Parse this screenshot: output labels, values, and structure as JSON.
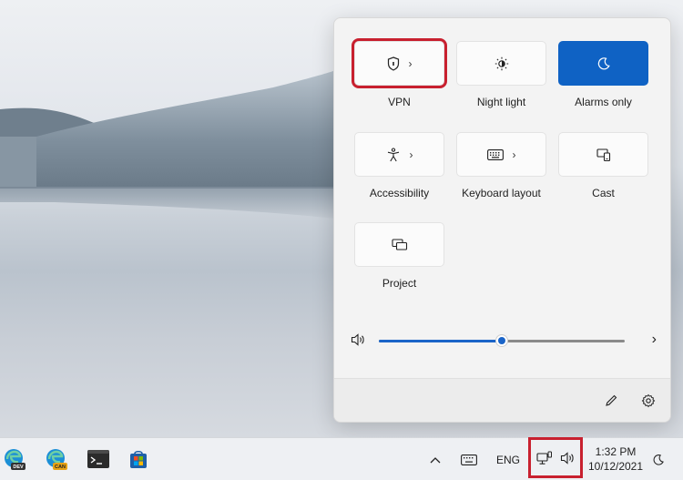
{
  "quick_settings": {
    "tiles": [
      {
        "label": "VPN",
        "icon": "shield-icon",
        "has_chevron": true,
        "active": false,
        "highlighted": true
      },
      {
        "label": "Night light",
        "icon": "brightness-icon",
        "has_chevron": false,
        "active": false,
        "highlighted": false
      },
      {
        "label": "Alarms only",
        "icon": "moon-icon",
        "has_chevron": false,
        "active": true,
        "highlighted": false
      },
      {
        "label": "Accessibility",
        "icon": "accessibility-icon",
        "has_chevron": true,
        "active": false,
        "highlighted": false
      },
      {
        "label": "Keyboard layout",
        "icon": "keyboard-icon",
        "has_chevron": true,
        "active": false,
        "highlighted": false
      },
      {
        "label": "Cast",
        "icon": "cast-icon",
        "has_chevron": false,
        "active": false,
        "highlighted": false
      },
      {
        "label": "Project",
        "icon": "project-icon",
        "has_chevron": false,
        "active": false,
        "highlighted": false
      }
    ],
    "volume": {
      "level": 0.5,
      "icon": "speaker-icon",
      "more_icon": "chevron-right-icon"
    },
    "footer": {
      "edit_icon": "pencil-icon",
      "settings_icon": "gear-icon"
    }
  },
  "taskbar": {
    "apps": [
      {
        "name": "Edge Dev",
        "badge": "DEV"
      },
      {
        "name": "Edge Canary",
        "badge": "CAN"
      },
      {
        "name": "Terminal",
        "badge": ""
      },
      {
        "name": "Microsoft Store",
        "badge": ""
      }
    ],
    "tray": {
      "chevron_icon": "chevron-up-icon",
      "keyboard_icon": "keyboard-icon",
      "language": "ENG",
      "network_icon": "network-icon",
      "volume_icon": "speaker-icon",
      "focus_icon": "moon-icon"
    },
    "time": "1:32 PM",
    "date": "10/12/2021"
  },
  "colors": {
    "accent": "#0f62c4",
    "highlight": "#c8202f",
    "panel_bg": "#f3f3f3"
  }
}
